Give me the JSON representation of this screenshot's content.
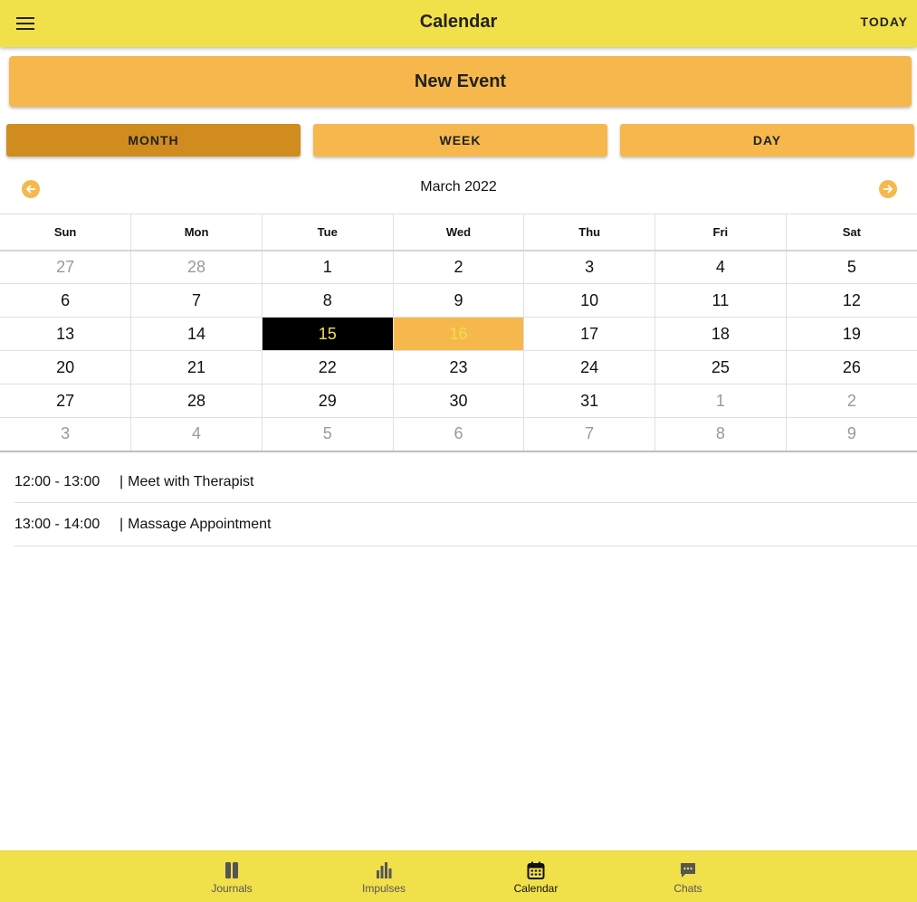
{
  "appbar": {
    "title": "Calendar",
    "today_label": "TODAY",
    "menu_icon": "menu-icon"
  },
  "new_event_label": "New Event",
  "view_buttons": {
    "month": "MONTH",
    "week": "WEEK",
    "day": "DAY",
    "active": "month"
  },
  "month_title": "March 2022",
  "weekdays": [
    "Sun",
    "Mon",
    "Tue",
    "Wed",
    "Thu",
    "Fri",
    "Sat"
  ],
  "weeks": [
    [
      "27",
      "28",
      "1",
      "2",
      "3",
      "4",
      "5"
    ],
    [
      "6",
      "7",
      "8",
      "9",
      "10",
      "11",
      "12"
    ],
    [
      "13",
      "14",
      "15",
      "16",
      "17",
      "18",
      "19"
    ],
    [
      "20",
      "21",
      "22",
      "23",
      "24",
      "25",
      "26"
    ],
    [
      "27",
      "28",
      "29",
      "30",
      "31",
      "1",
      "2"
    ],
    [
      "3",
      "4",
      "5",
      "6",
      "7",
      "8",
      "9"
    ]
  ],
  "selected_day": "15",
  "today_day": "16",
  "events": [
    {
      "time": "12:00 - 13:00",
      "title": "Meet with Therapist"
    },
    {
      "time": "13:00 - 14:00",
      "title": "Massage Appointment"
    }
  ],
  "bottom_nav": [
    {
      "label": "Journals",
      "icon": "book-icon",
      "active": false
    },
    {
      "label": "Impulses",
      "icon": "bar-chart-icon",
      "active": false
    },
    {
      "label": "Calendar",
      "icon": "calendar-icon",
      "active": true
    },
    {
      "label": "Chats",
      "icon": "chat-icon",
      "active": false
    }
  ],
  "colors": {
    "appbar": "#f0e04a",
    "accent": "#f6b84d",
    "accent_dark": "#d08c1f",
    "selected_bg": "#000000",
    "selected_text": "#f0e04a"
  }
}
